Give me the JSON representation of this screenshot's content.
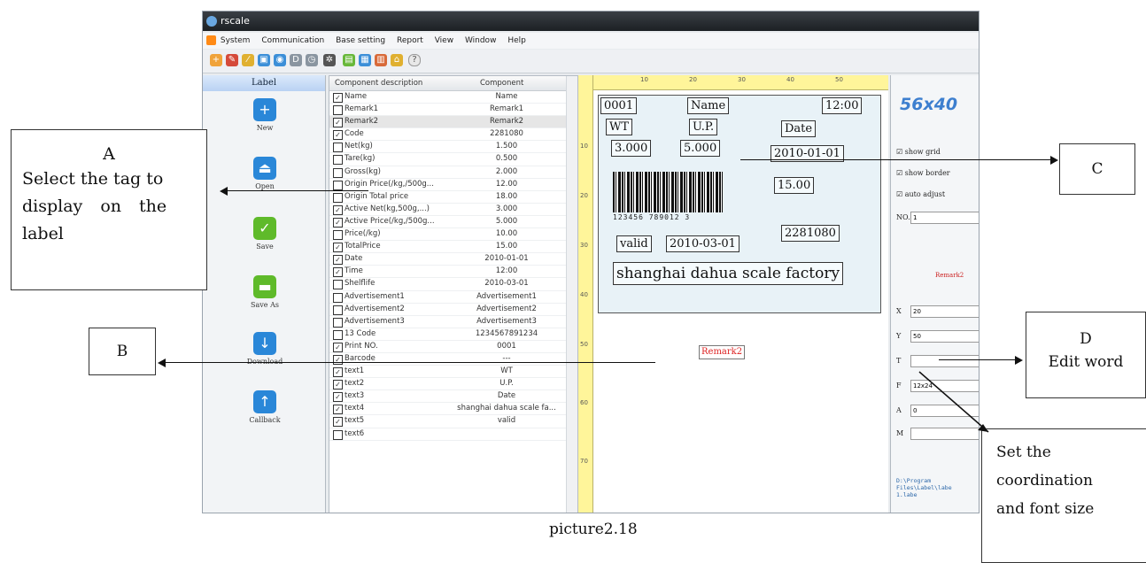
{
  "window": {
    "title": "rscale"
  },
  "menu": [
    "System",
    "Communication",
    "Base setting",
    "Report",
    "View",
    "Window",
    "Help"
  ],
  "left_panel": {
    "header": "Label",
    "buttons": [
      "New",
      "Open",
      "Save",
      "Save As",
      "Download",
      "Callback"
    ]
  },
  "component_list": {
    "headers": [
      "Component description",
      "Component"
    ],
    "rows": [
      {
        "checked": true,
        "desc": "Name",
        "val": "Name"
      },
      {
        "checked": false,
        "desc": "Remark1",
        "val": "Remark1"
      },
      {
        "checked": true,
        "desc": "Remark2",
        "val": "Remark2"
      },
      {
        "checked": true,
        "desc": "Code",
        "val": "2281080"
      },
      {
        "checked": false,
        "desc": "Net(kg)",
        "val": "1.500"
      },
      {
        "checked": false,
        "desc": "Tare(kg)",
        "val": "0.500"
      },
      {
        "checked": false,
        "desc": "Gross(kg)",
        "val": "2.000"
      },
      {
        "checked": false,
        "desc": "Origin Price(/kg,/500g...",
        "val": "12.00"
      },
      {
        "checked": false,
        "desc": "Origin Total price",
        "val": "18.00"
      },
      {
        "checked": true,
        "desc": "Active Net(kg,500g,...)",
        "val": "3.000"
      },
      {
        "checked": true,
        "desc": "Active Price(/kg,/500g...",
        "val": "5.000"
      },
      {
        "checked": false,
        "desc": "Price(/kg)",
        "val": "10.00"
      },
      {
        "checked": true,
        "desc": "TotalPrice",
        "val": "15.00"
      },
      {
        "checked": true,
        "desc": "Date",
        "val": "2010-01-01"
      },
      {
        "checked": true,
        "desc": "Time",
        "val": "12:00"
      },
      {
        "checked": false,
        "desc": "Shelflife",
        "val": "2010-03-01"
      },
      {
        "checked": false,
        "desc": "Advertisement1",
        "val": "Advertisement1"
      },
      {
        "checked": false,
        "desc": "Advertisement2",
        "val": "Advertisement2"
      },
      {
        "checked": false,
        "desc": "Advertisement3",
        "val": "Advertisement3"
      },
      {
        "checked": false,
        "desc": "13 Code",
        "val": "1234567891234"
      },
      {
        "checked": true,
        "desc": "Print NO.",
        "val": "0001"
      },
      {
        "checked": true,
        "desc": "Barcode",
        "val": "---"
      },
      {
        "checked": true,
        "desc": "text1",
        "val": "WT"
      },
      {
        "checked": true,
        "desc": "text2",
        "val": "U.P."
      },
      {
        "checked": true,
        "desc": "text3",
        "val": "Date"
      },
      {
        "checked": true,
        "desc": "text4",
        "val": "shanghai dahua scale fa..."
      },
      {
        "checked": true,
        "desc": "text5",
        "val": "valid"
      },
      {
        "checked": false,
        "desc": "text6",
        "val": ""
      }
    ]
  },
  "ruler": {
    "top": [
      "10",
      "20",
      "30",
      "40",
      "50"
    ],
    "left": [
      "10",
      "20",
      "30",
      "40",
      "50",
      "60",
      "70"
    ]
  },
  "label": {
    "print_no": "0001",
    "name": "Name",
    "time": "12:00",
    "wt": "WT",
    "up": "U.P.",
    "date_label": "Date",
    "net": "3.000",
    "price": "5.000",
    "date": "2010-01-01",
    "total": "15.00",
    "barcode_digits": "123456 789012 3",
    "code": "2281080",
    "valid": "valid",
    "valid_date": "2010-03-01",
    "company": "shanghai dahua scale factory",
    "remark2": "Remark2"
  },
  "right_panel": {
    "size": "56x40",
    "options": [
      "show grid",
      "show border",
      "auto adjust"
    ],
    "no_label": "NO.",
    "no_value": "1",
    "remark_label": "Remark2",
    "fields": [
      {
        "label": "X",
        "value": "20"
      },
      {
        "label": "Y",
        "value": "50"
      },
      {
        "label": "T",
        "value": ""
      },
      {
        "label": "F",
        "value": "12x24"
      },
      {
        "label": "A",
        "value": "0"
      },
      {
        "label": "M",
        "value": ""
      }
    ],
    "path_lines": [
      "D:\\Program",
      "Files\\Label\\labe",
      "1.labe"
    ]
  },
  "annotations": {
    "A": {
      "letter": "A",
      "lines": [
        "Select the tag to",
        "display on the",
        "label"
      ]
    },
    "B": {
      "letter": "B"
    },
    "C": {
      "letter": "C"
    },
    "D": {
      "letter": "D",
      "text": "Edit word"
    },
    "E": {
      "lines": [
        "Set the",
        "coordination",
        "and font size"
      ]
    }
  },
  "caption": "picture2.18"
}
